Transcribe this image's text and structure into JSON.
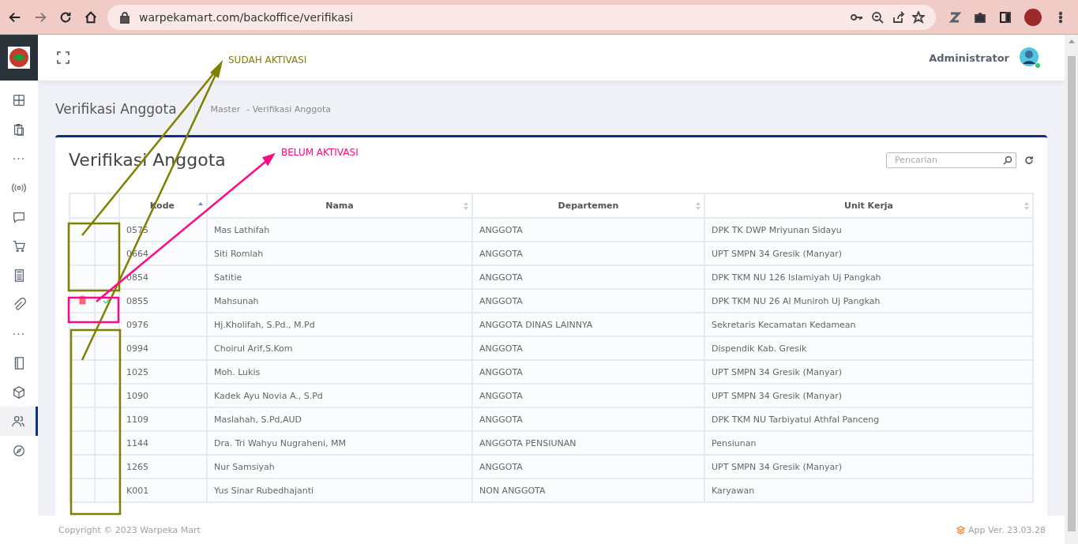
{
  "browser": {
    "url": "warpekamart.com/backoffice/verifikasi"
  },
  "sidebar": {
    "items": [
      {
        "kind": "grid",
        "selected": false
      },
      {
        "kind": "clipboard",
        "selected": false
      },
      {
        "kind": "more",
        "label": "···",
        "selected": false
      },
      {
        "kind": "broadcast",
        "selected": false
      },
      {
        "kind": "chat",
        "selected": false
      },
      {
        "kind": "cart",
        "selected": false
      },
      {
        "kind": "calculator",
        "selected": false
      },
      {
        "kind": "clip",
        "selected": false
      },
      {
        "kind": "more",
        "label": "···",
        "selected": false
      },
      {
        "kind": "book",
        "selected": false
      },
      {
        "kind": "box",
        "selected": false
      },
      {
        "kind": "users",
        "selected": true
      },
      {
        "kind": "compass",
        "selected": false
      }
    ]
  },
  "header": {
    "user": "Administrator"
  },
  "page": {
    "title": "Verifikasi Anggota",
    "breadcrumb": [
      "Master",
      "- Verifikasi Anggota"
    ]
  },
  "card": {
    "title": "Verifikasi Anggota",
    "search": {
      "placeholder": "Pencarian"
    }
  },
  "table": {
    "columns": [
      {
        "label": "Kode",
        "sorted": true
      },
      {
        "label": "Nama",
        "sorted": false
      },
      {
        "label": "Departemen",
        "sorted": false
      },
      {
        "label": "Unit Kerja",
        "sorted": false
      }
    ],
    "rows": [
      {
        "pending": false,
        "cells": [
          "0575",
          "Mas Lathifah",
          "ANGGOTA",
          "DPK TK DWP Mriyunan Sidayu"
        ]
      },
      {
        "pending": false,
        "cells": [
          "0664",
          "Siti Romlah",
          "ANGGOTA",
          "UPT SMPN 34 Gresik (Manyar)"
        ]
      },
      {
        "pending": false,
        "cells": [
          "0854",
          "Satitie",
          "ANGGOTA",
          "DPK TKM NU 126 Islamiyah Uj Pangkah"
        ]
      },
      {
        "pending": true,
        "cells": [
          "0855",
          "Mahsunah",
          "ANGGOTA",
          "DPK TKM NU 26 Al Muniroh Uj Pangkah"
        ]
      },
      {
        "pending": false,
        "cells": [
          "0976",
          "Hj.Kholifah, S.Pd., M.Pd",
          "ANGGOTA DINAS LAINNYA",
          "Sekretaris Kecamatan Kedamean"
        ]
      },
      {
        "pending": false,
        "cells": [
          "0994",
          "Choirul Arif,S.Kom",
          "ANGGOTA",
          "Dispendik Kab. Gresik"
        ]
      },
      {
        "pending": false,
        "cells": [
          "1025",
          "Moh. Lukis",
          "ANGGOTA",
          "UPT SMPN 34 Gresik (Manyar)"
        ]
      },
      {
        "pending": false,
        "cells": [
          "1090",
          "Kadek Ayu Novia A., S.Pd",
          "ANGGOTA",
          "UPT SMPN 34 Gresik (Manyar)"
        ]
      },
      {
        "pending": false,
        "cells": [
          "1109",
          "Maslahah, S.Pd,AUD",
          "ANGGOTA",
          "DPK TKM NU Tarbiyatul Athfal Panceng"
        ]
      },
      {
        "pending": false,
        "cells": [
          "1144",
          "Dra. Tri Wahyu Nugraheni, MM",
          "ANGGOTA PENSIUNAN",
          "Pensiunan"
        ]
      },
      {
        "pending": false,
        "cells": [
          "1265",
          "Nur Samsiyah",
          "ANGGOTA",
          "UPT SMPN 34 Gresik (Manyar)"
        ]
      },
      {
        "pending": false,
        "cells": [
          "K001",
          "Yus Sinar Rubedhajanti",
          "NON ANGGOTA",
          "Karyawan"
        ]
      }
    ]
  },
  "footer": {
    "copyright": "Copyright © 2023 Warpeka Mart",
    "version": "App Ver. 23.03.28"
  },
  "annotations": [
    {
      "label": "SUDAH AKTIVASI",
      "color": "#808000"
    },
    {
      "label": "BELUM AKTIVASI",
      "color": "#ff0a84"
    }
  ]
}
